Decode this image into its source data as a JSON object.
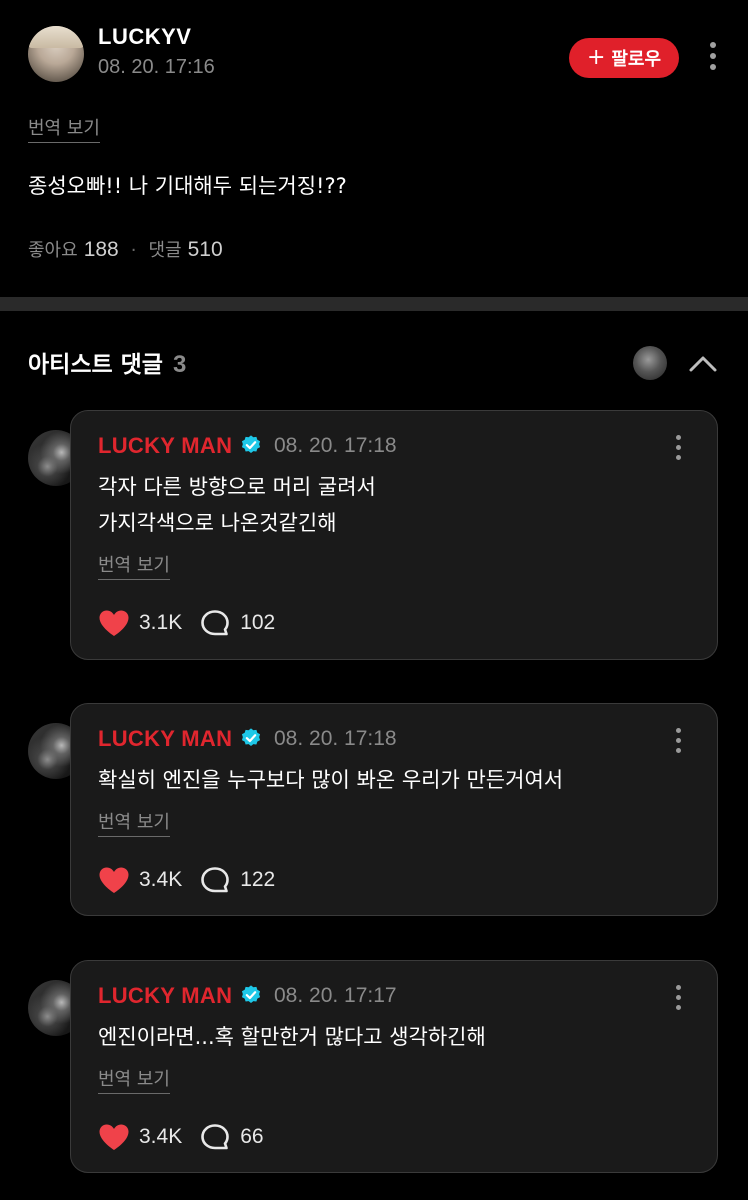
{
  "post": {
    "author": "LUCKYV",
    "time": "08. 20. 17:16",
    "follow_label": "팔로우",
    "follow_icon": "+",
    "translate_label": "번역 보기",
    "body": "종성오빠!! 나 기대해두 되는거징!??",
    "likes_label": "좋아요",
    "likes": "188",
    "stats_separator": "·",
    "comments_label": "댓글",
    "comments": "510"
  },
  "artist_comments": {
    "title": "아티스트 댓글",
    "count": "3"
  },
  "comments": [
    {
      "author": "LUCKY MAN",
      "time": "08. 20. 17:18",
      "lines": [
        "각자 다른 방향으로 머리 굴려서",
        "가지각색으로 나온것같긴해"
      ],
      "translate_label": "번역 보기",
      "likes": "3.1K",
      "replies": "102"
    },
    {
      "author": "LUCKY MAN",
      "time": "08. 20. 17:18",
      "lines": [
        "확실히 엔진을 누구보다 많이 봐온 우리가 만든거여서"
      ],
      "translate_label": "번역 보기",
      "likes": "3.4K",
      "replies": "122"
    },
    {
      "author": "LUCKY MAN",
      "time": "08. 20. 17:17",
      "lines": [
        "엔진이라면...혹 할만한거 많다고 생각하긴해"
      ],
      "translate_label": "번역 보기",
      "likes": "3.4K",
      "replies": "66"
    }
  ],
  "icons": {
    "verified": "verified-badge-icon",
    "like": "heart-icon",
    "reply": "speech-bubble-icon",
    "more": "more-vertical-icon",
    "collapse": "chevron-up-icon"
  },
  "colors": {
    "background": "#000000",
    "card": "#1a1a1a",
    "accent_red": "#e0202a",
    "verified_cyan": "#1ec8e8",
    "heart": "#f0424a",
    "muted_text": "#8a8a8a"
  }
}
